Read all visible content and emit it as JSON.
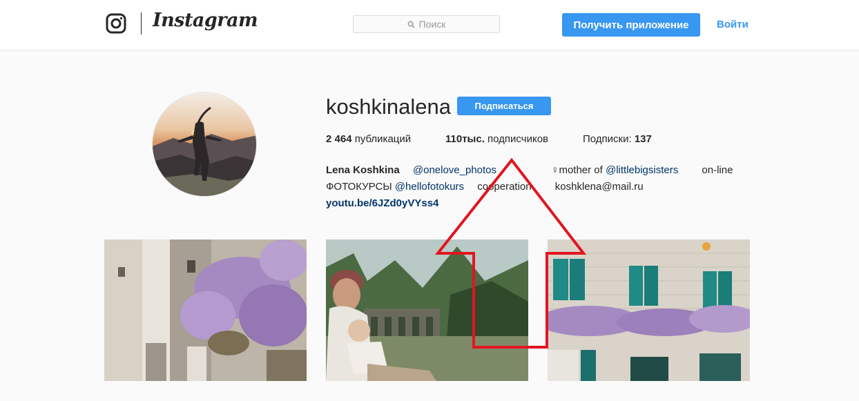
{
  "header": {
    "brand": "Instagram",
    "search_placeholder": "Поиск",
    "get_app_label": "Получить приложение",
    "login_label": "Войти"
  },
  "profile": {
    "username": "koshkinalena",
    "follow_label": "Подписаться",
    "stats": {
      "posts_count": "2 464",
      "posts_label": "публикаций",
      "followers_count": "110тыс.",
      "followers_label": "подписчиков",
      "following_label": "Подписки:",
      "following_count": "137"
    },
    "bio": {
      "name": "Lena Koshkina",
      "line1_a": "  ",
      "mention1": "@onelove_photos",
      "line1_b": "      ♀mother of ",
      "mention2": "@littlebigsisters",
      "line1_c": "   on-line",
      "line2_a": "ФОТОКУРСЫ ",
      "mention3": "@hellofotokurs",
      "line2_b": "  cooperation   koshklena@mail.ru",
      "website": "youtu.be/6JZd0yVYss4"
    }
  },
  "colors": {
    "accent": "#3897f0",
    "annotation": "#e3141f"
  }
}
